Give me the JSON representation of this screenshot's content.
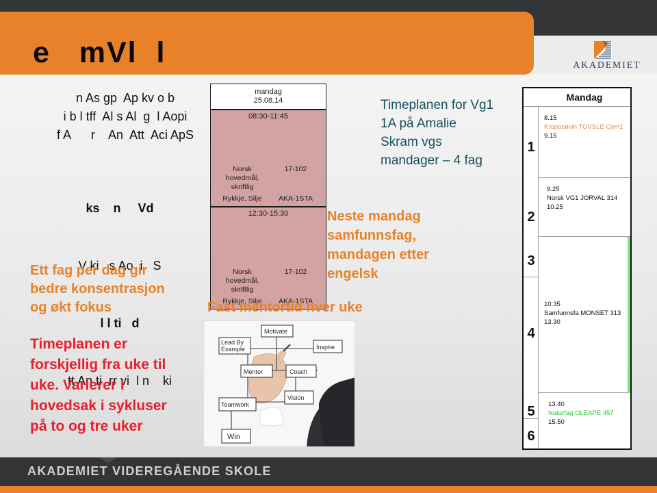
{
  "slide": {
    "title": "e   mVl  l",
    "logo": {
      "wordmark": "AKADEMIET",
      "mark_name": "akademiet-logo-mark"
    },
    "footer": {
      "text": "AKADEMIET VIDEREGÅENDE SKOLE"
    },
    "colors": {
      "orange": "#e8822a",
      "dark": "#333436",
      "red": "#e8202a",
      "teal": "#16505c",
      "green": "#7ce87c",
      "timetable_pink": "#d3a3a3"
    }
  },
  "left": {
    "garbled_block_1": "n As gp  Ap kv o b\ni b l tff  Al s Al  g  l Aopi\nf A      r    An  Att  Aci ApS",
    "garbled_block_2_line1": "ks    n     Vd",
    "garbled_block_2_line2": "V ki   s Ao  i   S",
    "garbled_block_2_line3": "l l ti   d",
    "garbled_block_2_line4": "tt An ti  rr vi  l n    ki",
    "orange_text": "Ett fag per dag gir\nbedre konsentrasjon\nog økt fokus",
    "red_text": "Timeplanen er\nforskjellig fra uke til\nuke. Varierer i\nhovedsak i sykluser\npå to og tre uker"
  },
  "timetable": {
    "day": "mandag",
    "date": "25.08.14",
    "slots": [
      {
        "time": "08:30-11:45",
        "subject": "Norsk\nhovedmål,\nskriftlig",
        "room": "17-102",
        "teacher": "Rykkje, Silje",
        "class": "AKA-1STA"
      },
      {
        "time": "12:30-15:30",
        "subject": "Norsk\nhovedmål,\nskriftlig",
        "room": "17-102",
        "teacher": "Rykkje, Silje",
        "class": "AKA-1STA"
      }
    ]
  },
  "center": {
    "teal_text": "Timeplanen for Vg1\n1A på Amalie\nSkram vgs\nmandager – 4 fag",
    "orange_text": "Neste mandag\nsamfunnsfag,\nmandagen etter\nengelsk",
    "orange_line": "Fast mentortid hver uke"
  },
  "mentor_diagram": {
    "boxes": [
      "Lead By Example",
      "Motivate",
      "Inspire",
      "Mentor",
      "Coach",
      "Teamwork",
      "Vision",
      "Win"
    ]
  },
  "schedule": {
    "header": "Mandag",
    "rows": [
      {
        "number": "1",
        "start": "8.15",
        "subject": "Kroppsøvin  TOVSLE  Gym1",
        "end": "9.15",
        "color": "#e08a50",
        "green_bar": false
      },
      {
        "number": "2",
        "start": "9.25",
        "subject": "Norsk VG1  JORVAL  314",
        "end": "10.25",
        "color": "#111111",
        "green_bar": false
      },
      {
        "number": "3",
        "start": "",
        "subject": "",
        "end": "",
        "color": "#111111",
        "green_bar": true
      },
      {
        "number": "4",
        "start": "10.35",
        "subject": "Samfunnsfa  MONSET  313",
        "end": "13.30",
        "color": "#111111",
        "green_bar": true
      },
      {
        "number": "5",
        "start": "13.40",
        "subject": "Naturfag  OLEAPE  457",
        "end": "15.50",
        "color": "#2ec52e",
        "green_bar": false
      },
      {
        "number": "6",
        "start": "",
        "subject": "",
        "end": "",
        "color": "#111111",
        "green_bar": false
      }
    ]
  }
}
